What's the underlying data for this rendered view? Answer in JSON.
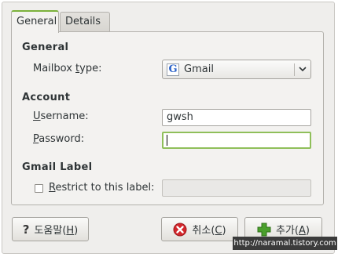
{
  "tabs": [
    {
      "label": "General",
      "active": true
    },
    {
      "label": "Details",
      "active": false
    }
  ],
  "general": {
    "title": "General",
    "mailbox_type_label_pre": "Mailbox ",
    "mailbox_type_label_access": "t",
    "mailbox_type_label_post": "ype:",
    "mailbox_type_value": "Gmail",
    "mailbox_type_icon": "G"
  },
  "account": {
    "title": "Account",
    "username_label_access": "U",
    "username_label_rest": "sername:",
    "username_value": "gwsh",
    "password_label_access": "P",
    "password_label_rest": "assword:",
    "password_value": ""
  },
  "gmail_label": {
    "title": "Gmail Label",
    "restrict_label_access": "R",
    "restrict_label_rest": "estrict to this label:",
    "restrict_checked": false,
    "label_value": ""
  },
  "buttons": {
    "help_icon": "?",
    "help_label_pre": "도움말(",
    "help_label_access": "H",
    "help_label_post": ")",
    "cancel_label_pre": "취소(",
    "cancel_label_access": "C",
    "cancel_label_post": ")",
    "add_label_pre": "추가(",
    "add_label_access": "A",
    "add_label_post": ")"
  },
  "colors": {
    "focus": "#8fbf5a",
    "tab_accent": "#7bb13b",
    "cancel_icon": "#d3262b",
    "add_icon": "#4aa02c"
  },
  "watermark": "http://naramal.tistory.com"
}
